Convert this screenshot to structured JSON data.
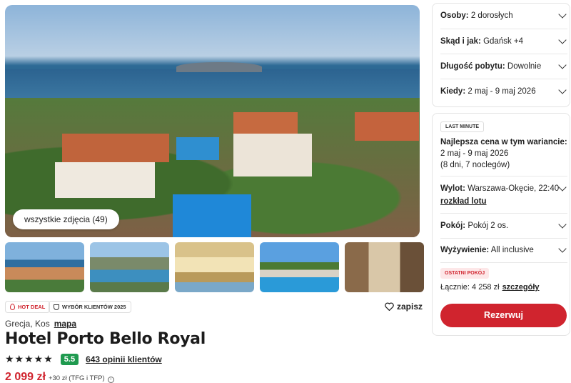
{
  "gallery": {
    "all_photos_label": "wszystkie zdjęcia (49)",
    "thumbnails": [
      "pool-aerial",
      "beach",
      "lobby",
      "pool",
      "room"
    ]
  },
  "tags": {
    "hot_deal": "HOT DEAL",
    "customer_choice": "WYBÓR KLIENTÓW 2025"
  },
  "save_label": "zapisz",
  "location": {
    "text": "Grecja, Kos",
    "map_link": "mapa"
  },
  "hotel": {
    "name": "Hotel Porto Bello Royal",
    "stars": "★★★★★",
    "score": "5.5",
    "reviews": "643 opinii klientów"
  },
  "price": {
    "main": "2 099 zł",
    "extra": "+30 zł (TFG i TFP)",
    "info": "i"
  },
  "filters": [
    {
      "label": "Osoby:",
      "value": "2 dorosłych"
    },
    {
      "label": "Skąd i jak:",
      "value": "Gdańsk +4"
    },
    {
      "label": "Długość pobytu:",
      "value": "Dowolnie"
    },
    {
      "label": "Kiedy:",
      "value": "2 maj - 9 maj 2026"
    }
  ],
  "offer": {
    "badge": "LAST MINUTE",
    "best_price_title": "Najlepsza cena w tym wariancie:",
    "dates": "2 maj - 9 maj 2026",
    "duration": "(8 dni, 7 noclegów)",
    "departure_label": "Wylot:",
    "departure_value": "Warszawa-Okęcie, 22:40",
    "flight_schedule": "rozkład lotu",
    "room_label": "Pokój:",
    "room_value": "Pokój 2 os.",
    "board_label": "Wyżywienie:",
    "board_value": "All inclusive",
    "last_room_badge": "OSTATNI POKÓJ",
    "total_label": "Łącznie: 4 258 zł",
    "details_link": "szczegóły",
    "reserve_button": "Rezerwuj"
  },
  "colors": {
    "accent_red": "#d0242e",
    "score_green": "#1f9a4f"
  }
}
